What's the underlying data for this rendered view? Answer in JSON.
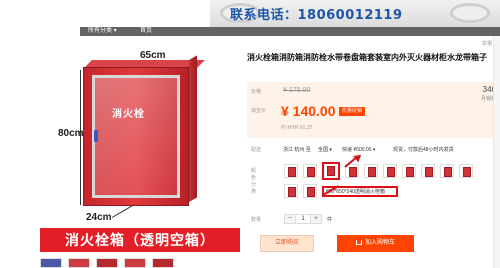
{
  "banner": {
    "phone_text": "联系电话：18060012119"
  },
  "nav": {
    "items": [
      {
        "label": "所有分类 ▾"
      },
      {
        "label": "首页"
      }
    ]
  },
  "top_corner": {
    "label": "举报"
  },
  "product_image": {
    "width_label": "65cm",
    "height_label": "80cm",
    "depth_label": "24cm",
    "glass_text": "消火栓",
    "caption": "消火栓箱（透明空箱）"
  },
  "product": {
    "title": "消火栓箱消防箱消防栓水带卷盘箱套装室内外灭火器材柜水龙带箱子",
    "price_label": "价格",
    "original_price": "¥ 175.00",
    "promo_label": "淘宝价",
    "sale_price": "¥ 140.00",
    "promo_badge": "优惠促销",
    "myr_text": "约 MYR 91.37",
    "sold_count": "346",
    "sold_label": "月销量",
    "shipping": {
      "label": "配送",
      "from": "浙江 杭州 至",
      "dest": "全国 ▾",
      "express": "快递 ¥500.00 ▾",
      "stock_text": "现货，付款后48小时内发货"
    },
    "color_label": "颜色分类",
    "selected_variant": "800*650*240透明消火栓箱",
    "quantity_label": "数量",
    "quantity_value": "1",
    "quantity_unit": "件",
    "buy_now_label": "立即购买",
    "add_cart_label": "加入购物车"
  },
  "colors": {
    "accent_red": "#e21f26",
    "orange": "#ff4400",
    "phone_blue": "#1d55a9"
  }
}
